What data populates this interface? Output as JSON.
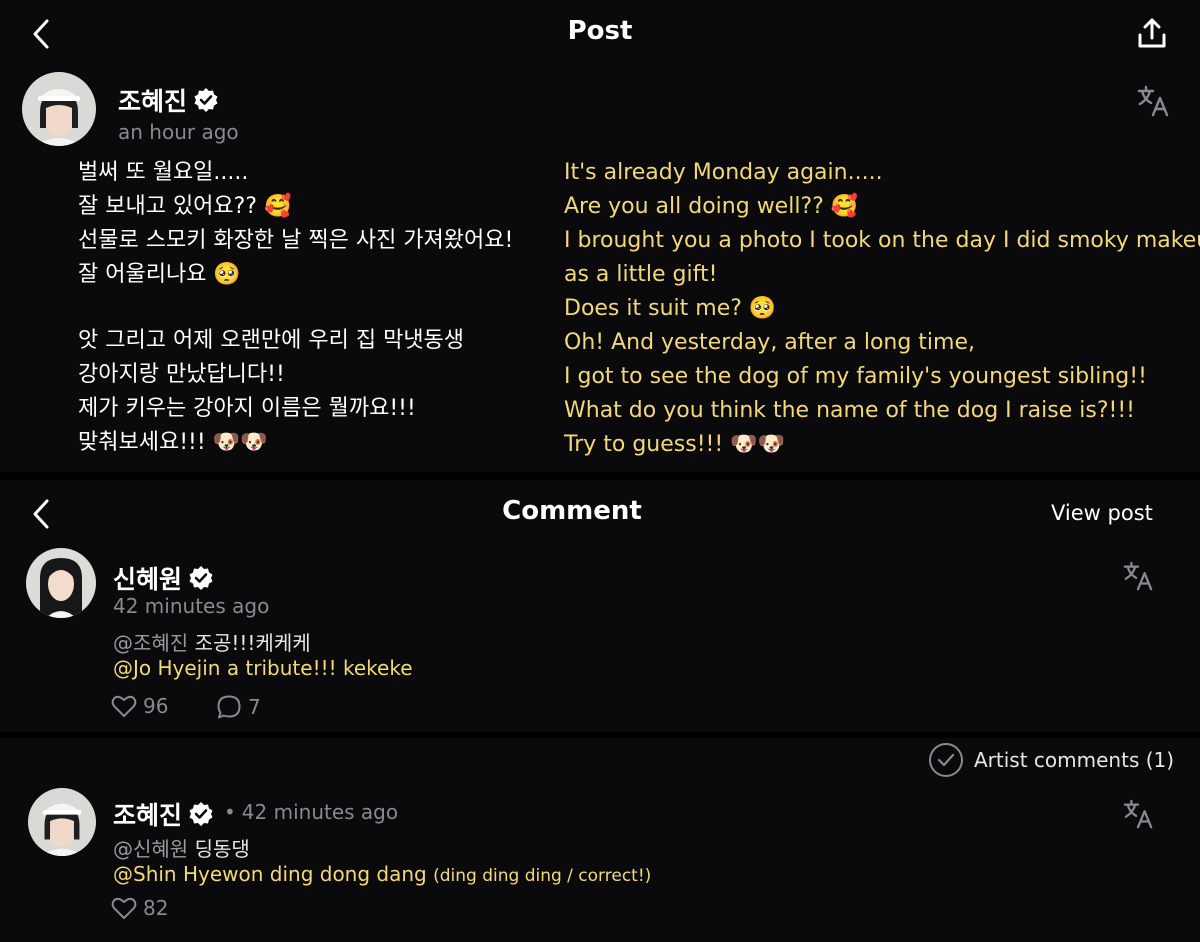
{
  "post": {
    "title": "Post",
    "author": {
      "name": "조혜진",
      "time": "an hour ago"
    },
    "korean_lines_1": [
      "벌써 또 월요일.....",
      "잘 보내고 있어요?? 🥰",
      "선물로 스모키 화장한 날 찍은 사진 가져왔어요!",
      "잘 어울리나요 🥺"
    ],
    "korean_lines_2": [
      "앗 그리고 어제 오랜만에 우리 집 막냇동생",
      "강아지랑 만났답니다!!",
      "제가 키우는 강아지 이름은 뭘까요!!!",
      "맞춰보세요!!! 🐶🐶"
    ],
    "english_lines_1": [
      "It's already Monday again.....",
      "Are you all doing well?? 🥰",
      "I brought you a photo I took on the day I did smoky makeup",
      "as a little gift!",
      "Does it suit me? 🥺"
    ],
    "english_lines_2": [
      "Oh! And yesterday, after a long time,",
      "I got to see the dog of my family's youngest sibling!!",
      "What do you think the name of the dog I raise is?!!!",
      "Try to guess!!! 🐶🐶"
    ]
  },
  "comment_header": {
    "title": "Comment",
    "view_post": "View post"
  },
  "comment": {
    "author": {
      "name": "신혜원",
      "time": "42 minutes ago"
    },
    "mention_kr": "@조혜진",
    "text_kr": "조공!!!케케케",
    "text_en": "@Jo Hyejin a tribute!!! kekeke",
    "likes": "96",
    "replies": "7"
  },
  "reply": {
    "artist_comments": "Artist comments (1)",
    "author": {
      "name": "조혜진",
      "time": "42 minutes ago"
    },
    "separator": "•",
    "mention_kr": "@신혜원",
    "text_kr": "딩동댕",
    "text_en": "@Shin Hyewon ding dong dang",
    "text_en_note": "(ding ding ding / correct!)",
    "likes": "82"
  },
  "colors": {
    "background": "#0a0a0c",
    "translation": "#f3d877",
    "muted": "#8a8a8e"
  },
  "icons": [
    "back-icon",
    "share-icon",
    "verified-icon",
    "translate-icon",
    "heart-icon",
    "comment-icon",
    "check-circle-icon"
  ]
}
